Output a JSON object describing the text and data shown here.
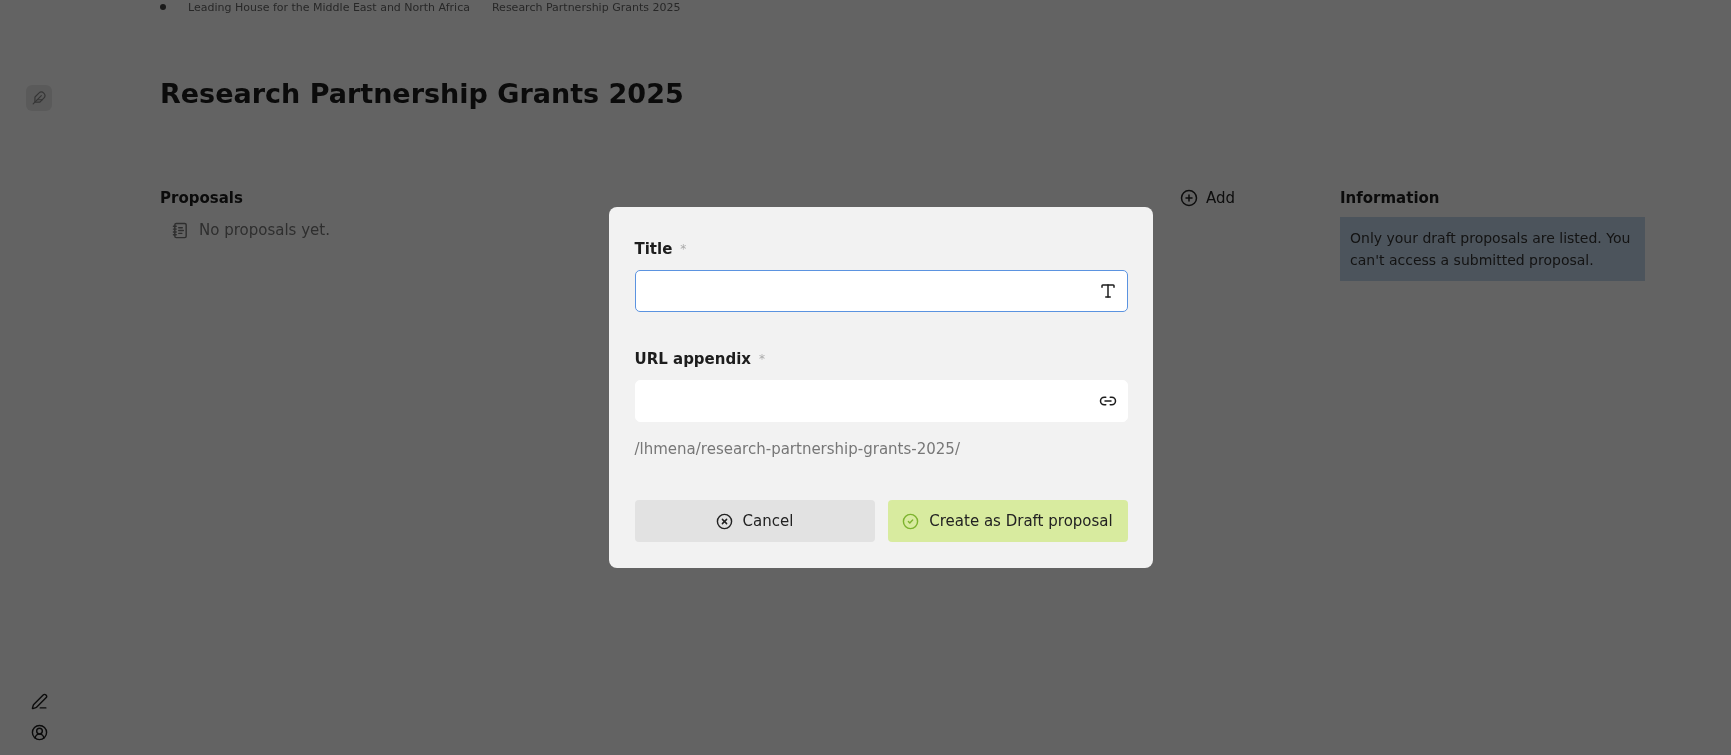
{
  "breadcrumb": [
    {
      "label": "Leading House for the Middle East and North Africa"
    },
    {
      "label": "Research Partnership Grants 2025"
    }
  ],
  "page_title": "Research Partnership Grants 2025",
  "proposals": {
    "heading": "Proposals",
    "add_label": "Add",
    "empty": "No proposals yet."
  },
  "information": {
    "heading": "Information",
    "text": "Only your draft proposals are listed. You can't access a submitted proposal."
  },
  "dialog": {
    "fields": [
      {
        "label": "Title",
        "marker": "*",
        "focused": true,
        "kind": "text"
      },
      {
        "label": "URL appendix",
        "marker": "*",
        "focused": false,
        "kind": "link",
        "hint": "/lhmena/research-partnership-grants-2025/"
      }
    ],
    "buttons": [
      {
        "label": "Cancel",
        "kind": "cancel"
      },
      {
        "label": "Create as Draft proposal",
        "kind": "confirm"
      }
    ]
  }
}
